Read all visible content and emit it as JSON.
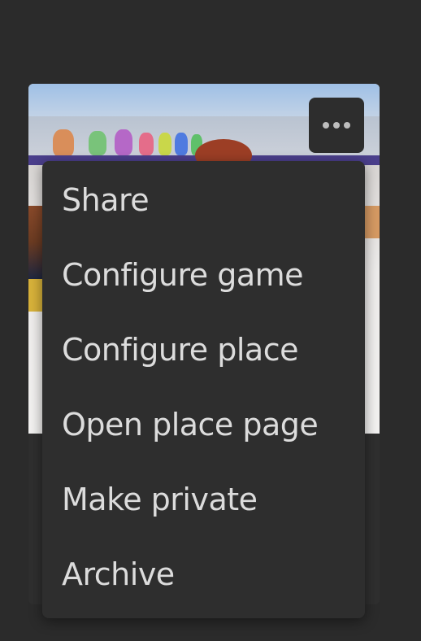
{
  "card": {
    "more_button_icon": "more-horizontal-icon"
  },
  "menu": {
    "items": [
      {
        "label": "Share"
      },
      {
        "label": "Configure game"
      },
      {
        "label": "Configure place"
      },
      {
        "label": "Open place page"
      },
      {
        "label": "Make private"
      },
      {
        "label": "Archive"
      }
    ]
  },
  "colors": {
    "background": "#2b2b2b",
    "menu_background": "#2e2e2e",
    "menu_text": "#dcdcdc",
    "more_button_background": "#2d2d2d"
  }
}
